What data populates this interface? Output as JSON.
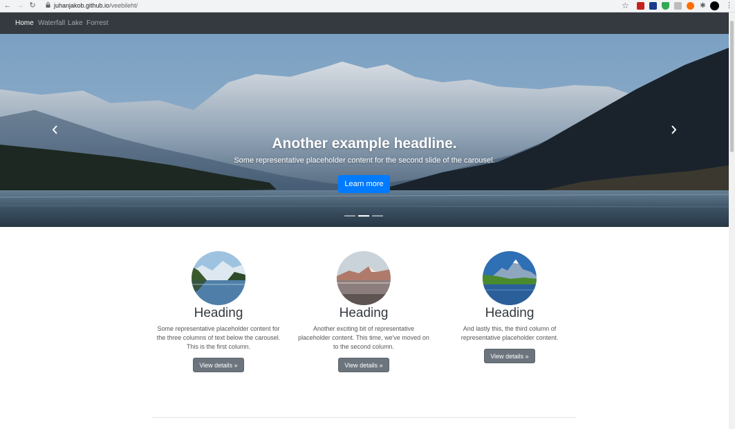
{
  "browser": {
    "url_domain": "juhanjakob.github.io",
    "url_path": "/veebileht/"
  },
  "navbar": {
    "items": [
      {
        "label": "Home",
        "active": true
      },
      {
        "label": "Waterfall",
        "active": false
      },
      {
        "label": "Lake",
        "active": false
      },
      {
        "label": "Forrest",
        "active": false
      }
    ]
  },
  "carousel": {
    "headline": "Another example headline.",
    "text": "Some representative placeholder content for the second slide of the carousel.",
    "button_label": "Learn more",
    "active_slide": 2,
    "slide_count": 3
  },
  "columns": [
    {
      "heading": "Heading",
      "text": "Some representative placeholder content for the three columns of text below the carousel. This is the first column.",
      "button_label": "View details »"
    },
    {
      "heading": "Heading",
      "text": "Another exciting bit of representative placeholder content. This time, we've moved on to the second column.",
      "button_label": "View details »"
    },
    {
      "heading": "Heading",
      "text": "And lastly this, the third column of representative placeholder content.",
      "button_label": "View details »"
    }
  ],
  "colors": {
    "navbar_bg": "#343a40",
    "primary": "#007bff",
    "secondary": "#6c757d"
  }
}
